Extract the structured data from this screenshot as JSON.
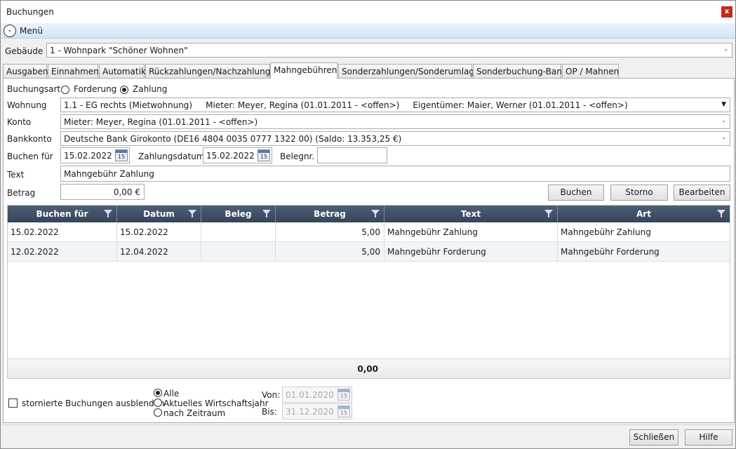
{
  "window": {
    "title": "Buchungen",
    "close_glyph": "x"
  },
  "menu": {
    "label": "Menü",
    "icon": "chevron-down-circle-icon"
  },
  "gebaeude": {
    "label": "Gebäude",
    "value": "1 - Wohnpark \"Schöner Wohnen\""
  },
  "tabs": [
    {
      "label": "Ausgaben"
    },
    {
      "label": "Einnahmen"
    },
    {
      "label": "Automatik"
    },
    {
      "label": "Rückzahlungen/Nachzahlungen"
    },
    {
      "label": "Mahngebühren",
      "active": true
    },
    {
      "label": "Sonderzahlungen/Sonderumlagen"
    },
    {
      "label": "Sonderbuchung-Bank"
    },
    {
      "label": "OP / Mahnen"
    }
  ],
  "form": {
    "buchungsart_label": "Buchungsart",
    "option_forderung": "Forderung",
    "option_zahlung": "Zahlung",
    "selected_option": "Zahlung",
    "wohnung_label": "Wohnung",
    "wohnung_value": "1.1 - EG rechts (Mietwohnung)     Mieter: Meyer, Regina (01.01.2011 - <offen>)     Eigentümer: Maier, Werner (01.01.2011 - <offen>)",
    "konto_label": "Konto",
    "konto_value": "Mieter: Meyer, Regina (01.01.2011 - <offen>)",
    "bankkonto_label": "Bankkonto",
    "bankkonto_value": "Deutsche Bank Girokonto (DE16 4804 0035 0777 1322 00) (Saldo: 13.353,25 €)",
    "buchen_fuer_label": "Buchen für",
    "buchen_fuer_value": "15.02.2022",
    "zahlungsdatum_label": "Zahlungsdatum",
    "zahlungsdatum_value": "15.02.2022",
    "belegnr_label": "Belegnr.",
    "belegnr_value": "",
    "text_label": "Text",
    "text_value": "Mahngebühr Zahlung",
    "betrag_label": "Betrag",
    "betrag_value": "0,00 €",
    "calendar_day": "15"
  },
  "actions": {
    "buchen": "Buchen",
    "storno": "Storno",
    "bearbeiten": "Bearbeiten"
  },
  "grid": {
    "columns": [
      "Buchen für",
      "Datum",
      "Beleg",
      "Betrag",
      "Text",
      "Art"
    ],
    "rows": [
      [
        "15.02.2022",
        "15.02.2022",
        "",
        "5,00",
        "Mahngebühr Zahlung",
        "Mahngebühr Zahlung"
      ],
      [
        "12.02.2022",
        "12.04.2022",
        "",
        "5,00",
        "Mahngebühr Forderung",
        "Mahngebühr Forderung"
      ]
    ],
    "total": "0,00"
  },
  "filter": {
    "hide_storno_label": "stornierte Buchungen ausblenden",
    "hide_storno_checked": false,
    "range_alle": "Alle",
    "range_wirtschaftsjahr": "Aktuelles Wirtschaftsjahr",
    "range_zeitraum": "nach Zeitraum",
    "selected_range": "Alle",
    "von_label": "Von:",
    "von_value": "01.01.2020",
    "bis_label": "Bis:",
    "bis_value": "31.12.2020"
  },
  "footer": {
    "schliessen": "Schließen",
    "hilfe": "Hilfe"
  }
}
